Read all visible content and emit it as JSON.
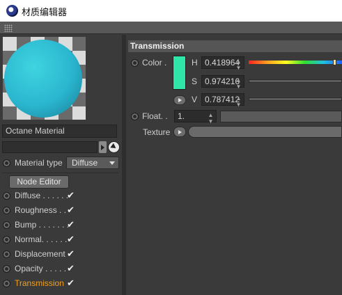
{
  "window": {
    "title": "材质编辑器"
  },
  "material": {
    "name": "Octane Material",
    "type_label": "Material type",
    "type_value": "Diffuse",
    "node_editor_label": "Node Editor"
  },
  "channels": [
    {
      "label": "Diffuse . . . . . .",
      "checked": true,
      "active": false
    },
    {
      "label": "Roughness . .",
      "checked": true,
      "active": false
    },
    {
      "label": "Bump . . . . . . .",
      "checked": true,
      "active": false
    },
    {
      "label": "Normal. . . . . .",
      "checked": true,
      "active": false
    },
    {
      "label": "Displacement",
      "checked": true,
      "active": false
    },
    {
      "label": "Opacity . . . . .",
      "checked": true,
      "active": false
    },
    {
      "label": "Transmission",
      "checked": true,
      "active": true
    }
  ],
  "checkmark": "✔",
  "transmission": {
    "header": "Transmission",
    "color_label": "Color .",
    "swatch_color": "#2ee6a8",
    "h_label": "H",
    "h_value": "0.418964",
    "s_label": "S",
    "s_value": "0.974216",
    "v_label": "V",
    "v_value": "0.787412",
    "spin_glyph": "▲▼",
    "float_label": "Float. .",
    "float_value": "1.",
    "texture_label": "Texture"
  },
  "colors": {
    "active_channel": "#f0a020",
    "panel_bg": "#3a3a3a",
    "header_bg": "#555555"
  },
  "icons": {
    "app": "cinema4d-logo-icon",
    "grip": "grip-dots-icon",
    "picker": "arrow-cursor-icon",
    "link": "chevron-right-icon"
  }
}
